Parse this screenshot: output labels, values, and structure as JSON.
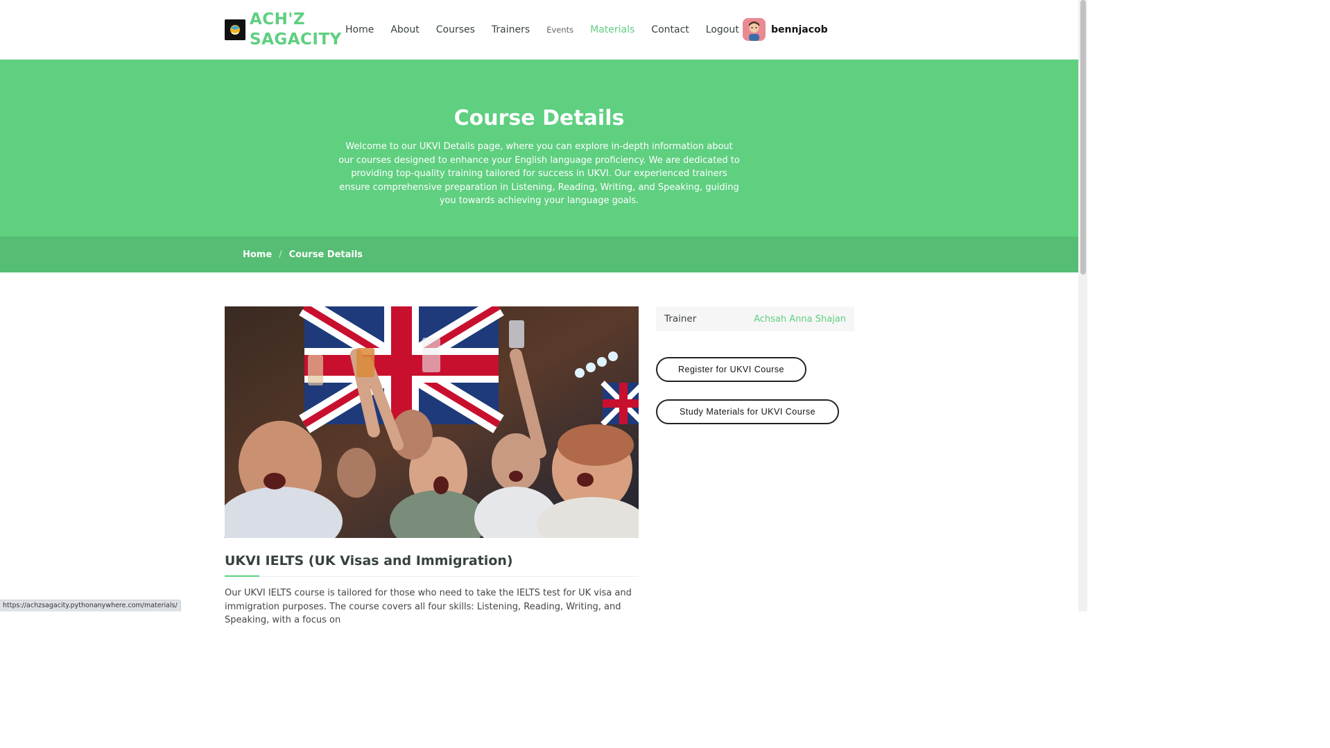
{
  "brand": {
    "line1": "ACH'Z",
    "line2": "SAGACITY"
  },
  "nav": {
    "items": [
      {
        "label": "Home"
      },
      {
        "label": "About"
      },
      {
        "label": "Courses"
      },
      {
        "label": "Trainers"
      },
      {
        "label": "Events"
      },
      {
        "label": "Materials"
      },
      {
        "label": "Contact"
      },
      {
        "label": "Logout"
      }
    ],
    "active_item": "Materials"
  },
  "user": {
    "name": "bennjacob"
  },
  "hero": {
    "title": "Course Details",
    "text": "Welcome to our UKVI Details page, where you can explore in-depth information about our courses designed to enhance your English language proficiency. We are dedicated to providing top-quality training tailored for success in UKVI. Our experienced trainers ensure comprehensive preparation in Listening, Reading, Writing, and Speaking, guiding you towards achieving your language goals."
  },
  "breadcrumb": {
    "home": "Home",
    "separator": "/",
    "current": "Course Details"
  },
  "course": {
    "title": "UKVI IELTS (UK Visas and Immigration)",
    "description": "Our UKVI IELTS course is tailored for those who need to take the IELTS test for UK visa and immigration purposes. The course covers all four skills: Listening, Reading, Writing, and Speaking, with a focus on"
  },
  "sidebar": {
    "trainer_label": "Trainer",
    "trainer_name": "Achsah Anna Shajan",
    "register_button": "Register for UKVI Course",
    "materials_button": "Study Materials for UKVI Course"
  },
  "status_bar": {
    "url": "https://achzsagacity.pythonanywhere.com/materials/"
  },
  "colors": {
    "accent": "#5fcf80",
    "breadcrumb_bg": "#56bd74",
    "text": "#37423b"
  }
}
